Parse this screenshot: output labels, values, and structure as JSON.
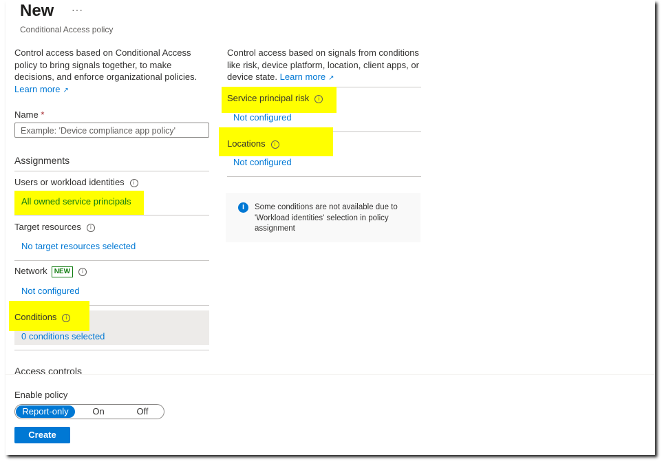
{
  "header": {
    "title": "New",
    "more": "···",
    "subtitle": "Conditional Access policy"
  },
  "left": {
    "description": "Control access based on Conditional Access policy to bring signals together, to make decisions, and enforce organizational policies.",
    "learn_more": "Learn more",
    "name_label": "Name",
    "required_mark": "*",
    "name_placeholder": "Example: 'Device compliance app policy'",
    "assignments_heading": "Assignments",
    "users_label": "Users or workload identities",
    "users_value": "All owned service principals",
    "target_label": "Target resources",
    "target_value": "No target resources selected",
    "network_label": "Network",
    "network_badge": "NEW",
    "network_value": "Not configured",
    "conditions_label": "Conditions",
    "conditions_value": "0 conditions selected",
    "access_controls_heading": "Access controls"
  },
  "right": {
    "description": "Control access based on signals from conditions like risk, device platform, location, client apps, or device state.",
    "learn_more": "Learn more",
    "sp_risk_label": "Service principal risk",
    "sp_risk_value": "Not configured",
    "locations_label": "Locations",
    "locations_value": "Not configured",
    "notice": "Some conditions are not available due to 'Workload identities' selection in policy assignment"
  },
  "footer": {
    "enable_policy_label": "Enable policy",
    "options": [
      "Report-only",
      "On",
      "Off"
    ],
    "selected": "Report-only",
    "create_label": "Create"
  },
  "colors": {
    "accent": "#0078d4",
    "highlight": "#ffff00",
    "new_badge": "#107c10"
  },
  "icons": [
    "info-icon",
    "external-link-icon"
  ]
}
